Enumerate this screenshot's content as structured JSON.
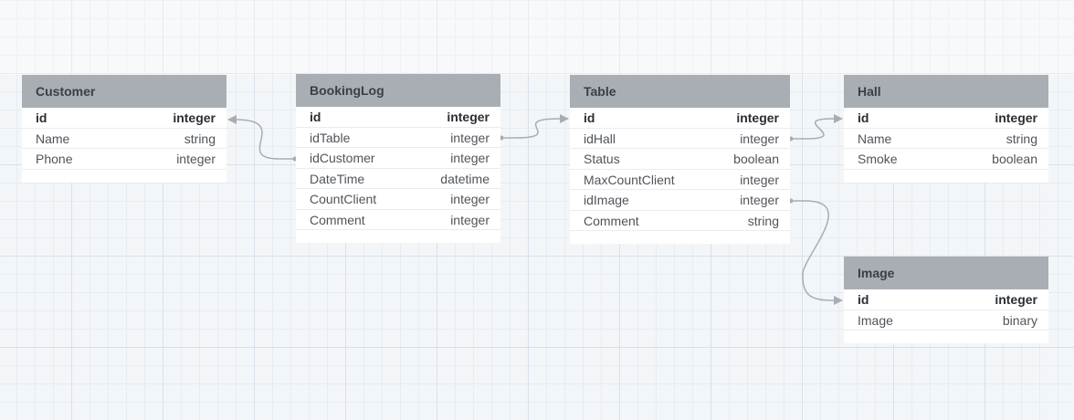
{
  "entities": {
    "customer": {
      "name": "Customer",
      "fields": [
        {
          "name": "id",
          "type": "integer"
        },
        {
          "name": "Name",
          "type": "string"
        },
        {
          "name": "Phone",
          "type": "integer"
        }
      ]
    },
    "bookinglog": {
      "name": "BookingLog",
      "fields": [
        {
          "name": "id",
          "type": "integer"
        },
        {
          "name": "idTable",
          "type": "integer"
        },
        {
          "name": "idCustomer",
          "type": "integer"
        },
        {
          "name": "DateTime",
          "type": "datetime"
        },
        {
          "name": "CountClient",
          "type": "integer"
        },
        {
          "name": "Comment",
          "type": "integer"
        }
      ]
    },
    "table": {
      "name": "Table",
      "fields": [
        {
          "name": "id",
          "type": "integer"
        },
        {
          "name": "idHall",
          "type": "integer"
        },
        {
          "name": "Status",
          "type": "boolean"
        },
        {
          "name": "MaxCountClient",
          "type": "integer"
        },
        {
          "name": "idImage",
          "type": "integer"
        },
        {
          "name": "Comment",
          "type": "string"
        }
      ]
    },
    "hall": {
      "name": "Hall",
      "fields": [
        {
          "name": "id",
          "type": "integer"
        },
        {
          "name": "Name",
          "type": "string"
        },
        {
          "name": "Smoke",
          "type": "boolean"
        }
      ]
    },
    "image": {
      "name": "Image",
      "fields": [
        {
          "name": "id",
          "type": "integer"
        },
        {
          "name": "Image",
          "type": "binary"
        }
      ]
    }
  },
  "colors": {
    "header_bg": "#a9aeb4",
    "connector": "#a7adb3",
    "grid_major": "#d7e0ea",
    "grid_minor": "#e6ecf2"
  }
}
